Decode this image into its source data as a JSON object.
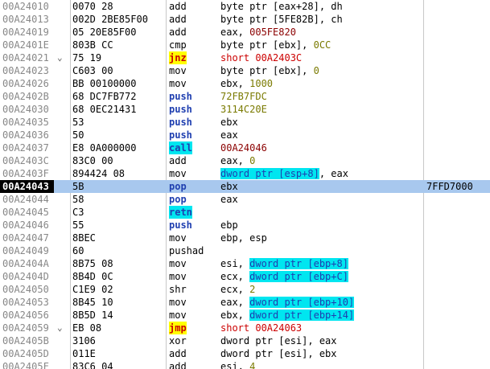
{
  "disassembly": {
    "rows": [
      {
        "addr": "00A24010",
        "hex": "0070 28",
        "mnemonic": "add",
        "operands": [
          {
            "t": "byte ptr [eax+28], dh"
          }
        ]
      },
      {
        "addr": "00A24013",
        "hex": "002D 2BE85F00",
        "mnemonic": "add",
        "operands": [
          {
            "t": "byte ptr [5FE82B], ch"
          }
        ]
      },
      {
        "addr": "00A24019",
        "hex": "05 20E85F00",
        "mnemonic": "add",
        "operands": [
          {
            "t": "eax, "
          },
          {
            "t": "005FE820",
            "c": "maroon"
          }
        ]
      },
      {
        "addr": "00A2401E",
        "hex": "803B CC",
        "mnemonic": "cmp",
        "operands": [
          {
            "t": "byte ptr [ebx], "
          },
          {
            "t": "0CC",
            "c": "olive"
          }
        ]
      },
      {
        "addr": "00A24021",
        "hex": "75 19",
        "mnemonic": "jnz",
        "mnStyle": "yellow",
        "jump": "v",
        "operands": [
          {
            "t": "short ",
            "c": "red"
          },
          {
            "t": "00A2403C",
            "c": "red"
          }
        ]
      },
      {
        "addr": "00A24023",
        "hex": "C603 00",
        "mnemonic": "mov",
        "operands": [
          {
            "t": "byte ptr [ebx], "
          },
          {
            "t": "0",
            "c": "olive"
          }
        ]
      },
      {
        "addr": "00A24026",
        "hex": "BB 00100000",
        "mnemonic": "mov",
        "operands": [
          {
            "t": "ebx, "
          },
          {
            "t": "1000",
            "c": "olive"
          }
        ]
      },
      {
        "addr": "00A2402B",
        "hex": "68 DC7FB772",
        "mnemonic": "push",
        "mnStyle": "blue",
        "operands": [
          {
            "t": "72FB7FDC",
            "c": "olive"
          }
        ]
      },
      {
        "addr": "00A24030",
        "hex": "68 0EC21431",
        "mnemonic": "push",
        "mnStyle": "blue",
        "operands": [
          {
            "t": "3114C20E",
            "c": "olive"
          }
        ]
      },
      {
        "addr": "00A24035",
        "hex": "53",
        "mnemonic": "push",
        "mnStyle": "blue",
        "operands": [
          {
            "t": "ebx"
          }
        ]
      },
      {
        "addr": "00A24036",
        "hex": "50",
        "mnemonic": "push",
        "mnStyle": "blue",
        "operands": [
          {
            "t": "eax"
          }
        ]
      },
      {
        "addr": "00A24037",
        "hex": "E8 0A000000",
        "mnemonic": "call",
        "mnStyle": "cyan",
        "operands": [
          {
            "t": "00A24046",
            "c": "maroon"
          }
        ]
      },
      {
        "addr": "00A2403C",
        "hex": "83C0 00",
        "mnemonic": "add",
        "operands": [
          {
            "t": "eax, "
          },
          {
            "t": "0",
            "c": "olive"
          }
        ]
      },
      {
        "addr": "00A2403F",
        "hex": "894424 08",
        "mnemonic": "mov",
        "operands": [
          {
            "t": "dword ptr [esp+8]",
            "c": "cyan"
          },
          {
            "t": ", eax"
          }
        ]
      },
      {
        "addr": "00A24043",
        "hex": "5B",
        "mnemonic": "pop",
        "mnStyle": "blue",
        "selected": true,
        "operands": [
          {
            "t": "ebx"
          }
        ],
        "comment": "7FFD7000"
      },
      {
        "addr": "00A24044",
        "hex": "58",
        "mnemonic": "pop",
        "mnStyle": "blue",
        "operands": [
          {
            "t": "eax"
          }
        ]
      },
      {
        "addr": "00A24045",
        "hex": "C3",
        "mnemonic": "retn",
        "mnStyle": "cyan",
        "operands": []
      },
      {
        "addr": "00A24046",
        "hex": "55",
        "mnemonic": "push",
        "mnStyle": "blue",
        "operands": [
          {
            "t": "ebp"
          }
        ]
      },
      {
        "addr": "00A24047",
        "hex": "8BEC",
        "mnemonic": "mov",
        "operands": [
          {
            "t": "ebp, esp"
          }
        ]
      },
      {
        "addr": "00A24049",
        "hex": "60",
        "mnemonic": "pushad",
        "operands": []
      },
      {
        "addr": "00A2404A",
        "hex": "8B75 08",
        "mnemonic": "mov",
        "operands": [
          {
            "t": "esi, "
          },
          {
            "t": "dword ptr [ebp+8]",
            "c": "cyan"
          }
        ]
      },
      {
        "addr": "00A2404D",
        "hex": "8B4D 0C",
        "mnemonic": "mov",
        "operands": [
          {
            "t": "ecx, "
          },
          {
            "t": "dword ptr [ebp+C]",
            "c": "cyan"
          }
        ]
      },
      {
        "addr": "00A24050",
        "hex": "C1E9 02",
        "mnemonic": "shr",
        "operands": [
          {
            "t": "ecx, "
          },
          {
            "t": "2",
            "c": "olive"
          }
        ]
      },
      {
        "addr": "00A24053",
        "hex": "8B45 10",
        "mnemonic": "mov",
        "operands": [
          {
            "t": "eax, "
          },
          {
            "t": "dword ptr [ebp+10]",
            "c": "cyan"
          }
        ]
      },
      {
        "addr": "00A24056",
        "hex": "8B5D 14",
        "mnemonic": "mov",
        "operands": [
          {
            "t": "ebx, "
          },
          {
            "t": "dword ptr [ebp+14]",
            "c": "cyan"
          }
        ]
      },
      {
        "addr": "00A24059",
        "hex": "EB 08",
        "mnemonic": "jmp",
        "mnStyle": "yellow",
        "jump": "v",
        "operands": [
          {
            "t": "short ",
            "c": "red"
          },
          {
            "t": "00A24063",
            "c": "red"
          }
        ]
      },
      {
        "addr": "00A2405B",
        "hex": "3106",
        "mnemonic": "xor",
        "operands": [
          {
            "t": "dword ptr [esi], eax"
          }
        ]
      },
      {
        "addr": "00A2405D",
        "hex": "011E",
        "mnemonic": "add",
        "operands": [
          {
            "t": "dword ptr [esi], ebx"
          }
        ]
      },
      {
        "addr": "00A2405F",
        "hex": "83C6 04",
        "mnemonic": "add",
        "operands": [
          {
            "t": "esi, "
          },
          {
            "t": "4",
            "c": "olive"
          }
        ]
      }
    ]
  },
  "colors": {
    "selection": "#a8c8ee",
    "address_highlight": "#000000",
    "cyan_highlight": "#00e6f0",
    "yellow_highlight": "#ffff00",
    "mnemonic_blue": "#1f3fb0",
    "constant_olive": "#7a7a00",
    "address_maroon": "#8b0000",
    "jump_red": "#cc0000"
  }
}
